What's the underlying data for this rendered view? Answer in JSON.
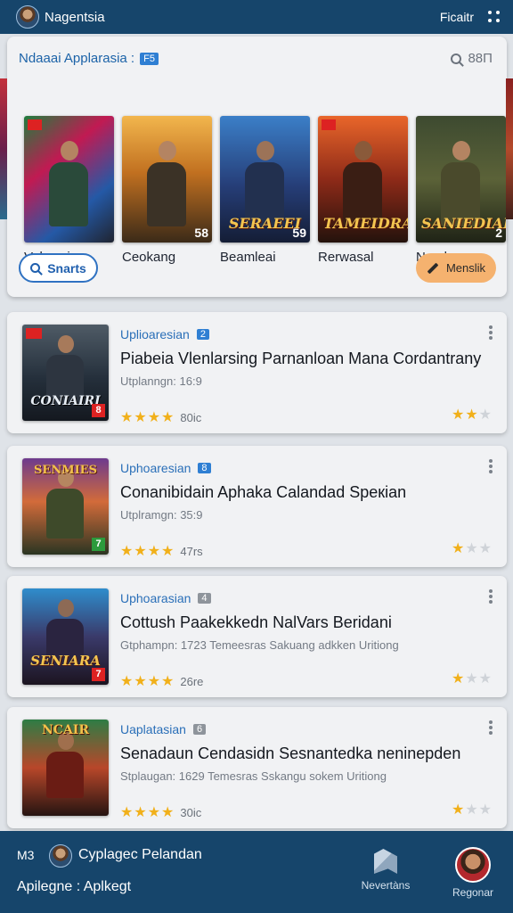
{
  "topbar": {
    "app_name": "Nagentsia",
    "right_label": "Ficaitr"
  },
  "featured": {
    "title": "Ndaaai Applarasia :",
    "badge": "F5",
    "search_count": "88Π",
    "tiles": [
      {
        "name": "Velawaia",
        "cover_text": "",
        "number": ""
      },
      {
        "name": "Ceokang",
        "cover_text": "",
        "number": "58"
      },
      {
        "name": "Beamleai",
        "cover_text": "SERAEEI",
        "number": "59"
      },
      {
        "name": "Rerwasal",
        "cover_text": "TAMEIDRA",
        "number": ""
      },
      {
        "name": "Nesdoga",
        "cover_text": "SANIEDIAI",
        "number": "2"
      }
    ],
    "search_button": "Snarts",
    "menu_button": "Menslik"
  },
  "cards": [
    {
      "category": "Uplioaresian",
      "count": "2",
      "title": "Piabeia Vlenlarsing Parnanloan Mana Cordantrany",
      "meta": "Utplanngn: 16:9",
      "rating_value": "80ic",
      "mini_stars_on": 2,
      "cover_text": "CONIAIRI",
      "tag": "8"
    },
    {
      "category": "Uphoaresian",
      "count": "8",
      "title": "Conanibidain Aphaka Calandad Speкian",
      "meta": "Utplramgn: 35:9",
      "rating_value": "47rs",
      "mini_stars_on": 1,
      "cover_text": "SENMIES",
      "tag": "7"
    },
    {
      "category": "Uphoarasian",
      "count": "4",
      "title": "Cottush Paakekkedn NalVars Beridani",
      "meta": "Gtphampn: 1723  Temeesras Sakuang adkken Uritiong",
      "rating_value": "26re",
      "mini_stars_on": 1,
      "cover_text": "SENIARA",
      "tag": "7"
    },
    {
      "category": "Uaplatasian",
      "count": "6",
      "title": "Senadaun Cendasidn Sesnantedka neninepden",
      "meta": "Stplaugan: 1629  Temesras Sskangu sokem Uritiong",
      "rating_value": "30ic",
      "mini_stars_on": 1,
      "cover_text": "NCAIR",
      "tag": ""
    }
  ],
  "bottombar": {
    "left_label": "M3",
    "user_name": "Cyplagec Pelandan",
    "row2": "Apilegne : Aplkegt",
    "nav_items": [
      {
        "label": "Nevertàns",
        "icon": "cube-icon"
      },
      {
        "label": "Regonar",
        "icon": "profile-avatar"
      }
    ]
  },
  "colors": {
    "topbar": "#16456b",
    "accent_blue": "#2f7fd3",
    "star": "#f1b01a",
    "menu_button": "#f5b26f"
  }
}
